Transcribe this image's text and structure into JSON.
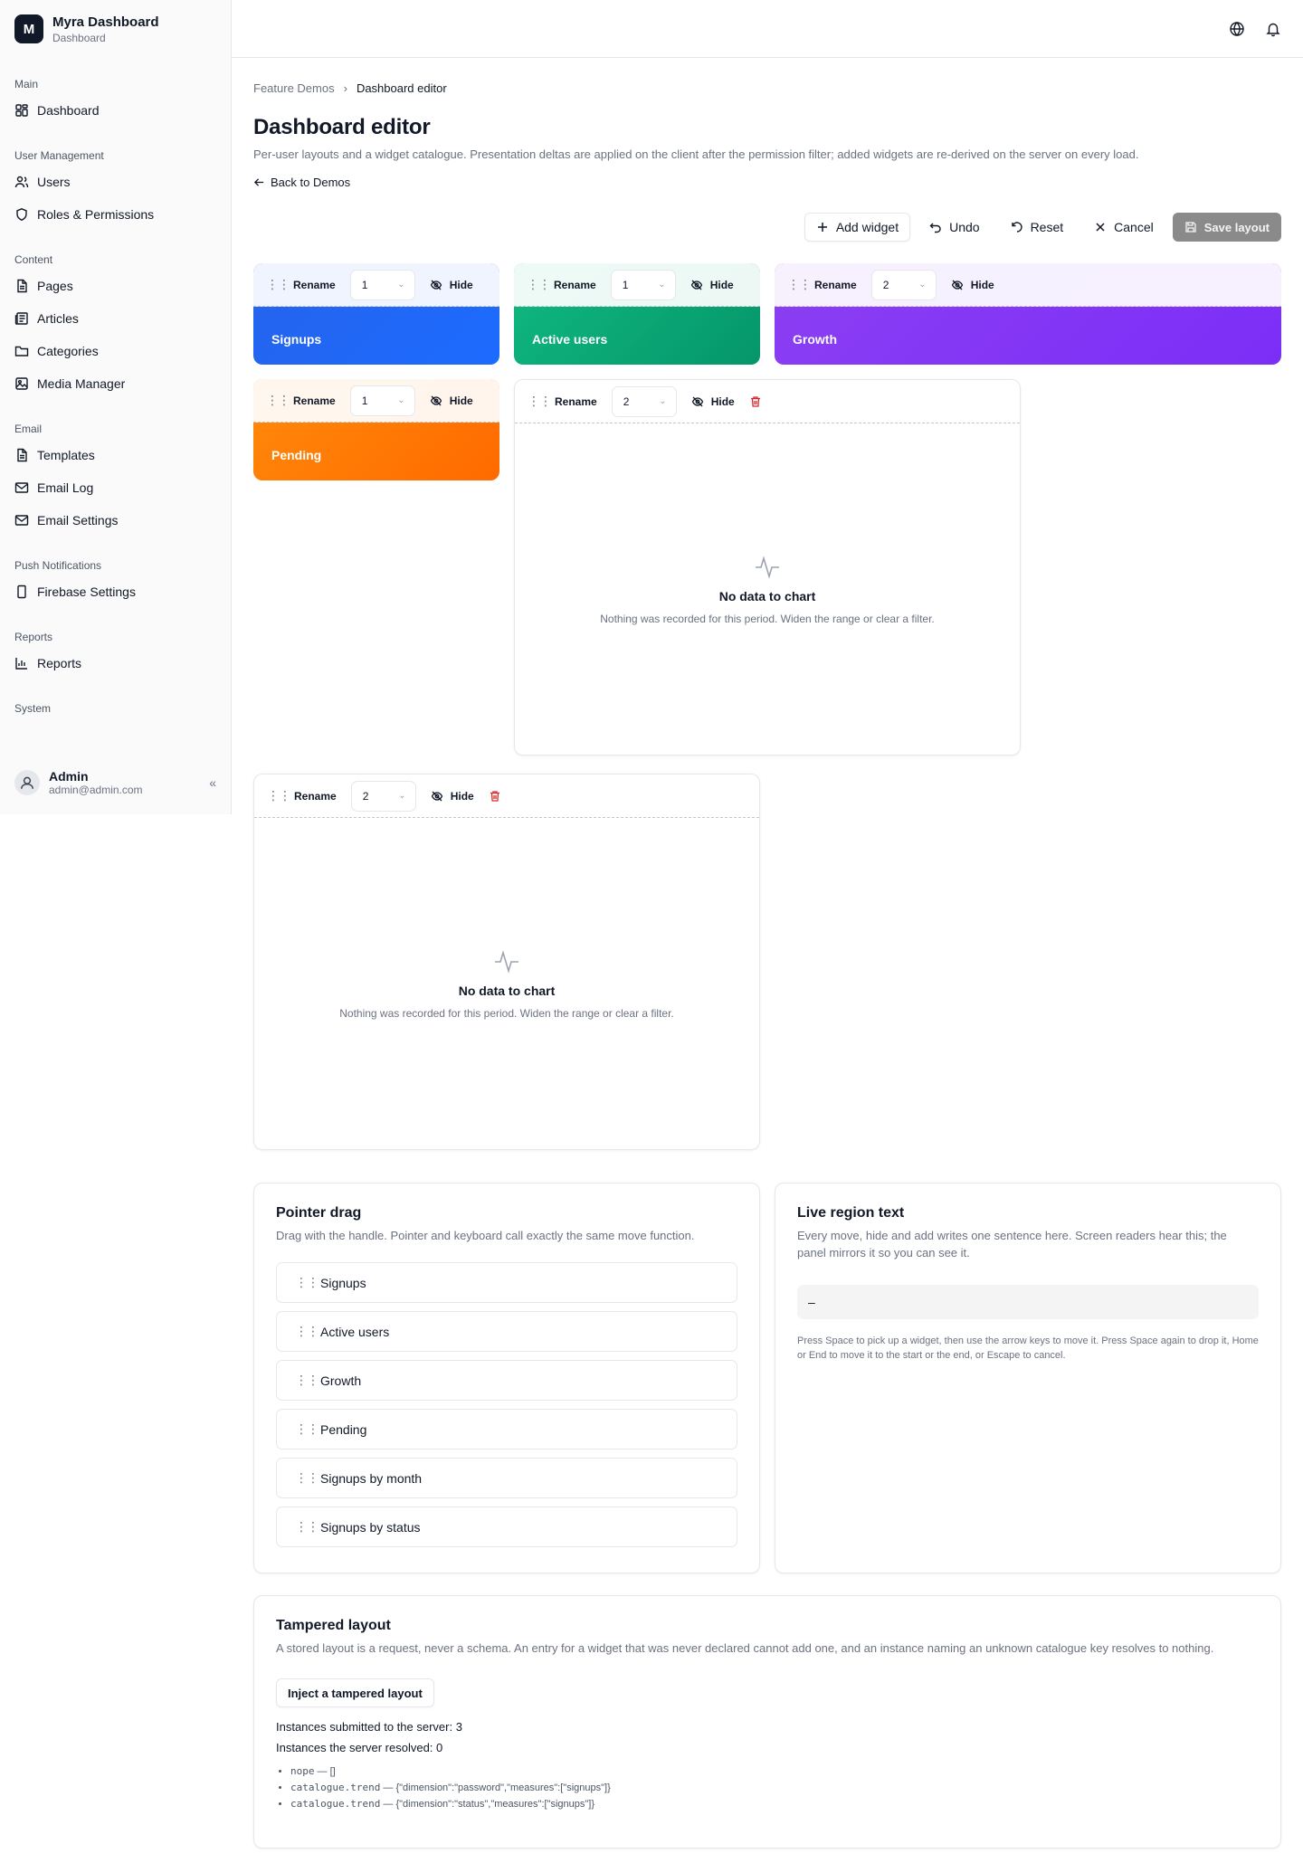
{
  "brand": {
    "logo": "M",
    "name": "Myra Dashboard",
    "sub": "Dashboard"
  },
  "sidebar": {
    "groups": [
      {
        "title": "Main",
        "items": [
          {
            "label": "Dashboard",
            "icon": "dashboard-icon"
          }
        ]
      },
      {
        "title": "User Management",
        "items": [
          {
            "label": "Users",
            "icon": "users-icon"
          },
          {
            "label": "Roles & Permissions",
            "icon": "shield-icon"
          }
        ]
      },
      {
        "title": "Content",
        "items": [
          {
            "label": "Pages",
            "icon": "file-icon"
          },
          {
            "label": "Articles",
            "icon": "newspaper-icon"
          },
          {
            "label": "Categories",
            "icon": "folder-icon"
          },
          {
            "label": "Media Manager",
            "icon": "image-icon"
          }
        ]
      },
      {
        "title": "Email",
        "items": [
          {
            "label": "Templates",
            "icon": "file-icon"
          },
          {
            "label": "Email Log",
            "icon": "mail-icon"
          },
          {
            "label": "Email Settings",
            "icon": "mail-settings-icon"
          }
        ]
      },
      {
        "title": "Push Notifications",
        "items": [
          {
            "label": "Firebase Settings",
            "icon": "phone-icon"
          }
        ]
      },
      {
        "title": "Reports",
        "items": [
          {
            "label": "Reports",
            "icon": "bar-chart-icon"
          }
        ]
      },
      {
        "title": "System",
        "items": []
      }
    ],
    "user": {
      "name": "Admin",
      "email": "admin@admin.com"
    }
  },
  "breadcrumb": {
    "parent": "Feature Demos",
    "current": "Dashboard editor"
  },
  "page": {
    "title": "Dashboard editor",
    "description": "Per-user layouts and a widget catalogue. Presentation deltas are applied on the client after the permission filter; added widgets are re-derived on the server on every load.",
    "back": "Back to Demos"
  },
  "toolbar": {
    "add": "Add widget",
    "undo": "Undo",
    "reset": "Reset",
    "cancel": "Cancel",
    "save": "Save layout"
  },
  "widget_controls": {
    "rename": "Rename",
    "hide": "Hide"
  },
  "widgets": [
    {
      "label": "Signups",
      "size": "1"
    },
    {
      "label": "Active users",
      "size": "1"
    },
    {
      "label": "Growth",
      "size": "2"
    },
    {
      "label": "Pending",
      "size": "1"
    },
    {
      "size": "2",
      "empty_title": "No data to chart",
      "empty_sub": "Nothing was recorded for this period. Widen the range or clear a filter."
    },
    {
      "size": "2",
      "empty_title": "No data to chart",
      "empty_sub": "Nothing was recorded for this period. Widen the range or clear a filter."
    }
  ],
  "pointer_drag": {
    "title": "Pointer drag",
    "desc": "Drag with the handle. Pointer and keyboard call exactly the same move function.",
    "items": [
      "Signups",
      "Active users",
      "Growth",
      "Pending",
      "Signups by month",
      "Signups by status"
    ]
  },
  "live_region": {
    "title": "Live region text",
    "desc": "Every move, hide and add writes one sentence here. Screen readers hear this; the panel mirrors it so you can see it.",
    "value": "–",
    "help": "Press Space to pick up a widget, then use the arrow keys to move it. Press Space again to drop it, Home or End to move it to the start or the end, or Escape to cancel."
  },
  "tampered": {
    "title": "Tampered layout",
    "desc": "A stored layout is a request, never a schema. An entry for a widget that was never declared cannot add one, and an instance naming an unknown catalogue key resolves to nothing.",
    "button": "Inject a tampered layout",
    "submitted": "Instances submitted to the server: 3",
    "resolved": "Instances the server resolved: 0",
    "entries": [
      {
        "key": "nope",
        "value": " — []"
      },
      {
        "key": "catalogue.trend",
        "value": " — {\"dimension\":\"password\",\"measures\":[\"signups\"]}"
      },
      {
        "key": "catalogue.trend",
        "value": " — {\"dimension\":\"status\",\"measures\":[\"signups\"]}"
      }
    ]
  }
}
